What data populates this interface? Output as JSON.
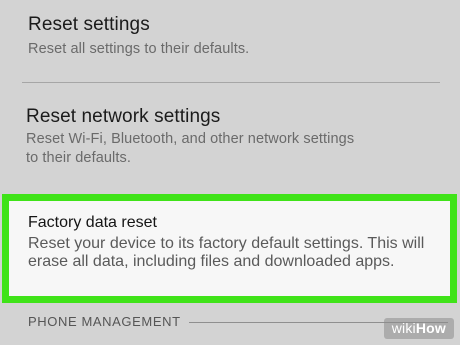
{
  "settings": {
    "reset_settings": {
      "title": "Reset settings",
      "summary": "Reset all settings to their defaults."
    },
    "reset_network": {
      "title": "Reset network settings",
      "summary_line1": "Reset Wi-Fi, Bluetooth, and other network settings",
      "summary_line2": "to their defaults."
    },
    "factory_reset": {
      "title": "Factory data reset",
      "summary_line1": "Reset your device to its factory default settings. This will",
      "summary_line2": "erase all data, including files and downloaded apps."
    }
  },
  "section_header": "PHONE MANAGEMENT",
  "watermark": {
    "wiki": "wiki",
    "how": "How"
  },
  "colors": {
    "background": "#d3d3d3",
    "highlight_border": "#3fe318",
    "highlight_fill": "#f7f7f7"
  }
}
